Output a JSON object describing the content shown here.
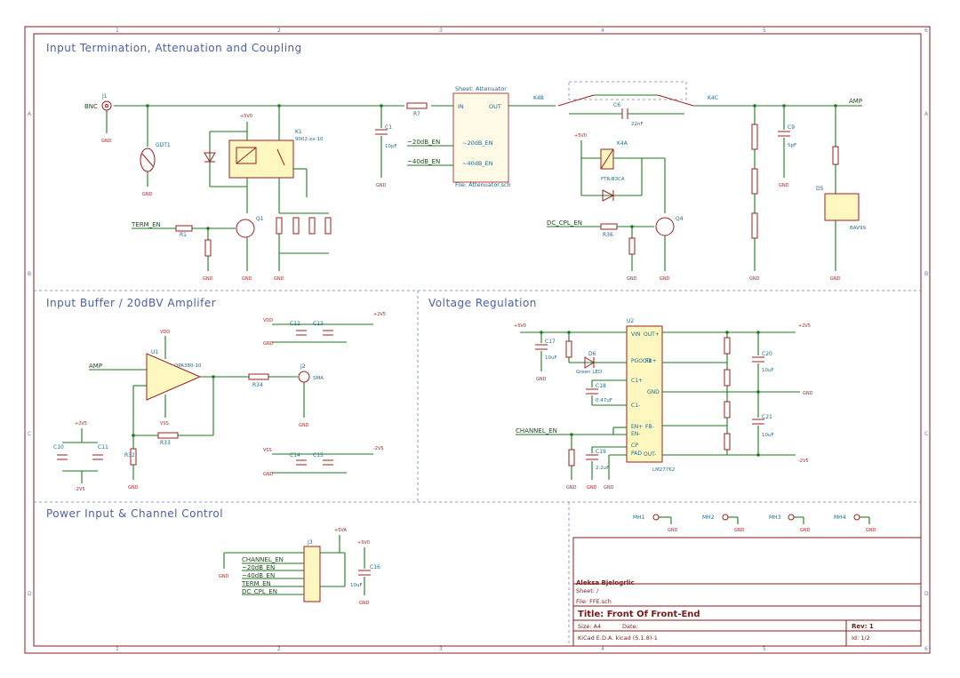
{
  "sections": {
    "input": "Input Termination, Attenuation and Coupling",
    "buffer": "Input Buffer / 20dBV Amplifer",
    "regulation": "Voltage Regulation",
    "power": "Power Input & Channel Control"
  },
  "coords": {
    "top": [
      "1",
      "2",
      "3",
      "4",
      "5",
      "6"
    ],
    "side": [
      "A",
      "B",
      "C",
      "D"
    ]
  },
  "net": {
    "bnc": "BNC",
    "amp": "AMP",
    "amp_in": "AMP",
    "term_en": "TERM_EN",
    "db20": "~20dB_EN",
    "db40": "~40dB_EN",
    "dc_cpl": "DC_CPL_EN",
    "channel_en": "CHANNEL_EN"
  },
  "parts": {
    "j1": "J1",
    "gdt": "GDT1",
    "k1": "K1",
    "k1_val": "9002-xx-10",
    "c1": "C1",
    "c1_val": "10pF",
    "r7": "R7",
    "q1": "Q1",
    "r1": "R1",
    "r2": "R2",
    "k4b": "K4B",
    "k4c": "K4C",
    "k4a": "K4A",
    "k4_val": "FTR-B3CA",
    "c6": "C6",
    "c6_val": "22nF",
    "c9": "C9",
    "c9_val": "5pF",
    "d5": "D5",
    "d5_val": "BAV99",
    "q4": "Q4",
    "r36": "R36",
    "u1": "U1",
    "u1_val": "OPA380-10",
    "j2": "J2",
    "j2_val": "SMA",
    "r34": "R34",
    "r33": "R33",
    "r32": "R32",
    "c10": "C10",
    "c11": "C11",
    "c12": "C12",
    "c13": "C13",
    "c14": "C14",
    "c15": "C15",
    "u2": "U2",
    "u2_val": "LM27762",
    "c17": "C17",
    "c17_val": "10uF",
    "d6": "D6",
    "d6_val": "Green LED",
    "c18": "C18",
    "c18_val": "0.47uF",
    "c19": "C19",
    "c19_val": "2.2uF",
    "c20": "C20",
    "c20_val": "10uF",
    "c21": "C21",
    "c21_val": "10uF",
    "j3": "J3",
    "c16": "C16",
    "c16_val": "10uF"
  },
  "sheet": {
    "name": "Sheet: Attenuator",
    "file": "File: Attenuator.sch",
    "in": "IN",
    "out": "OUT",
    "p20": "~20dB_EN",
    "p40": "~40dB_EN"
  },
  "u2pins": {
    "vin": "VIN",
    "pgood": "PGOOD",
    "c1p": "C1+",
    "c1m": "C1-",
    "enp": "EN+",
    "enm": "EN-",
    "cp": "CP",
    "pad": "PAD",
    "outp": "OUT+",
    "fbp": "FB+",
    "gnd": "GND",
    "fbm": "FB-",
    "outm": "OUT-"
  },
  "power": {
    "gnd": "GND",
    "p5v": "+5V0",
    "p2v5": "+2V5",
    "m2v5": "-2V5",
    "vdd": "VDD",
    "vss": "VSS",
    "p5va": "+5VA"
  },
  "mounting": [
    "MH1",
    "MH2",
    "MH3",
    "MH4"
  ],
  "connector": [
    "CHANNEL_EN",
    "~20dB_EN",
    "~40dB_EN",
    "TERM_EN",
    "DC_CPL_EN"
  ],
  "title_block": {
    "author": "Aleksa Bjelogrlic",
    "sheet": "Sheet: /",
    "file": "File: FFE.sch",
    "title": "Title: Front Of Front-End",
    "size": "Size: A4",
    "date": "Date:",
    "rev": "Rev: 1",
    "tool": "KiCad E.D.A.  kicad (5.1.8)-1",
    "id": "Id: 1/2"
  }
}
